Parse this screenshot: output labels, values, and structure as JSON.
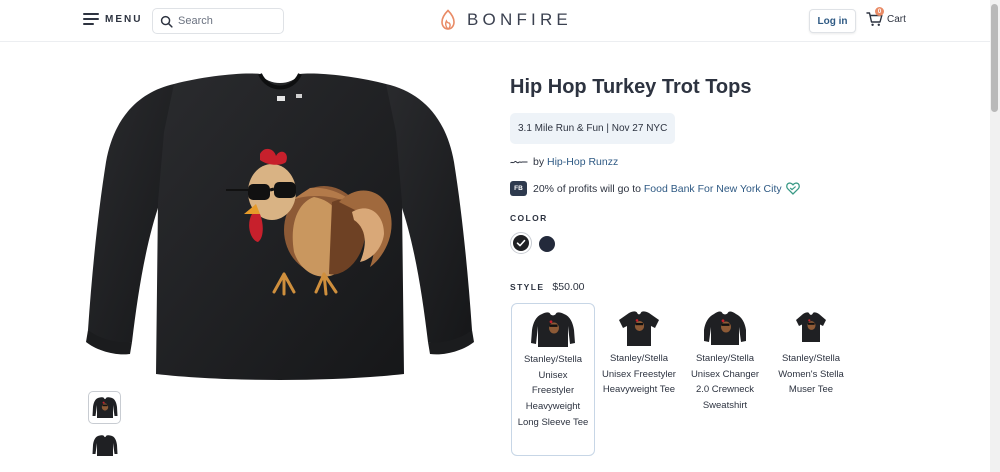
{
  "header": {
    "menu_label": "MENU",
    "search_placeholder": "Search",
    "brand": "BONFIRE",
    "login_label": "Log in",
    "cart_label": "Cart",
    "cart_count": "0"
  },
  "product": {
    "title": "Hip Hop Turkey Trot Tops",
    "event_tag": "3.1 Mile Run & Fun | Nov 27 NYC",
    "by_prefix": "by",
    "campaign_owner": "Hip-Hop Runzz",
    "charity_badge": "FB",
    "charity_prefix": "20% of profits will go to",
    "charity_name": "Food Bank For New York City",
    "color_label": "COLOR",
    "colors": [
      {
        "name": "black",
        "hex": "#1f2023",
        "selected": true
      },
      {
        "name": "navy",
        "hex": "#232a3b",
        "selected": false
      }
    ],
    "style_label": "STYLE",
    "price": "$50.00",
    "styles": [
      {
        "name": "Stanley/Stella Unisex Freestyler Heavyweight Long Sleeve Tee",
        "selected": true
      },
      {
        "name": "Stanley/Stella Unisex Freestyler Heavyweight Tee",
        "selected": false
      },
      {
        "name": "Stanley/Stella Unisex Changer 2.0 Crewneck Sweatshirt",
        "selected": false
      },
      {
        "name": "Stanley/Stella Women's Stella Muser Tee",
        "selected": false
      }
    ]
  },
  "colors": {
    "link": "#2f5a84",
    "text": "#2d3340",
    "accent": "#e98b66",
    "heart": "#3a9a86"
  }
}
